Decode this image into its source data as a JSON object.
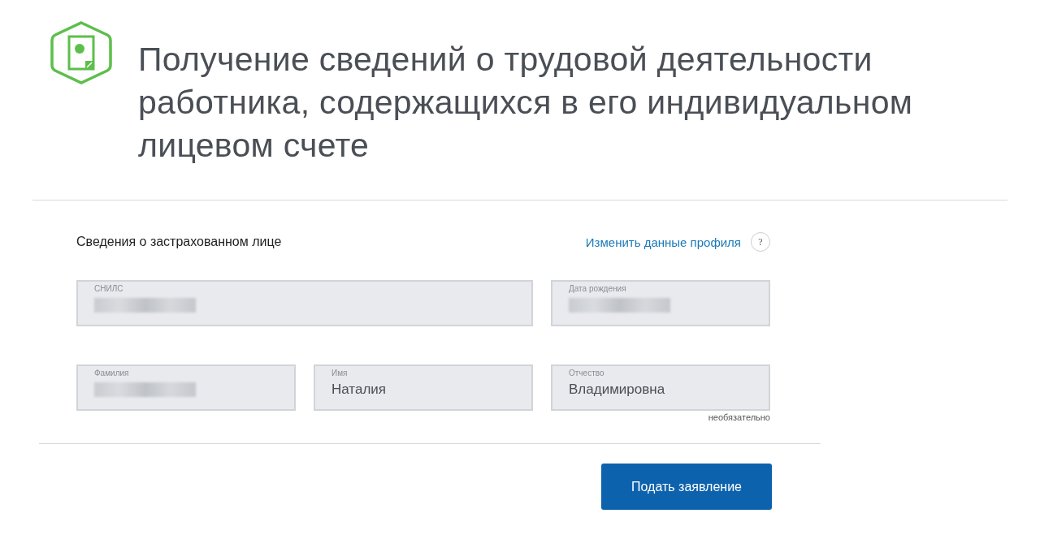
{
  "title": "Получение сведений о трудовой деятельности работника, содержащихся в его индивидуальном лицевом счете",
  "section": {
    "heading": "Сведения о застрахованном лице",
    "link": "Изменить данные профиля",
    "help": "?"
  },
  "rows": [
    {
      "fields": [
        {
          "label": "СНИЛС",
          "kind": "blurred"
        },
        {
          "label": "Дата рождения",
          "kind": "blurred"
        }
      ]
    },
    {
      "fields": [
        {
          "label": "Фамилия",
          "kind": "blurred"
        },
        {
          "label": "Имя",
          "kind": "text",
          "value": "Наталия"
        },
        {
          "label": "Отчество",
          "kind": "text",
          "value": "Владимировна",
          "hint": "необязательно"
        }
      ]
    }
  ],
  "submit": "Подать заявление"
}
